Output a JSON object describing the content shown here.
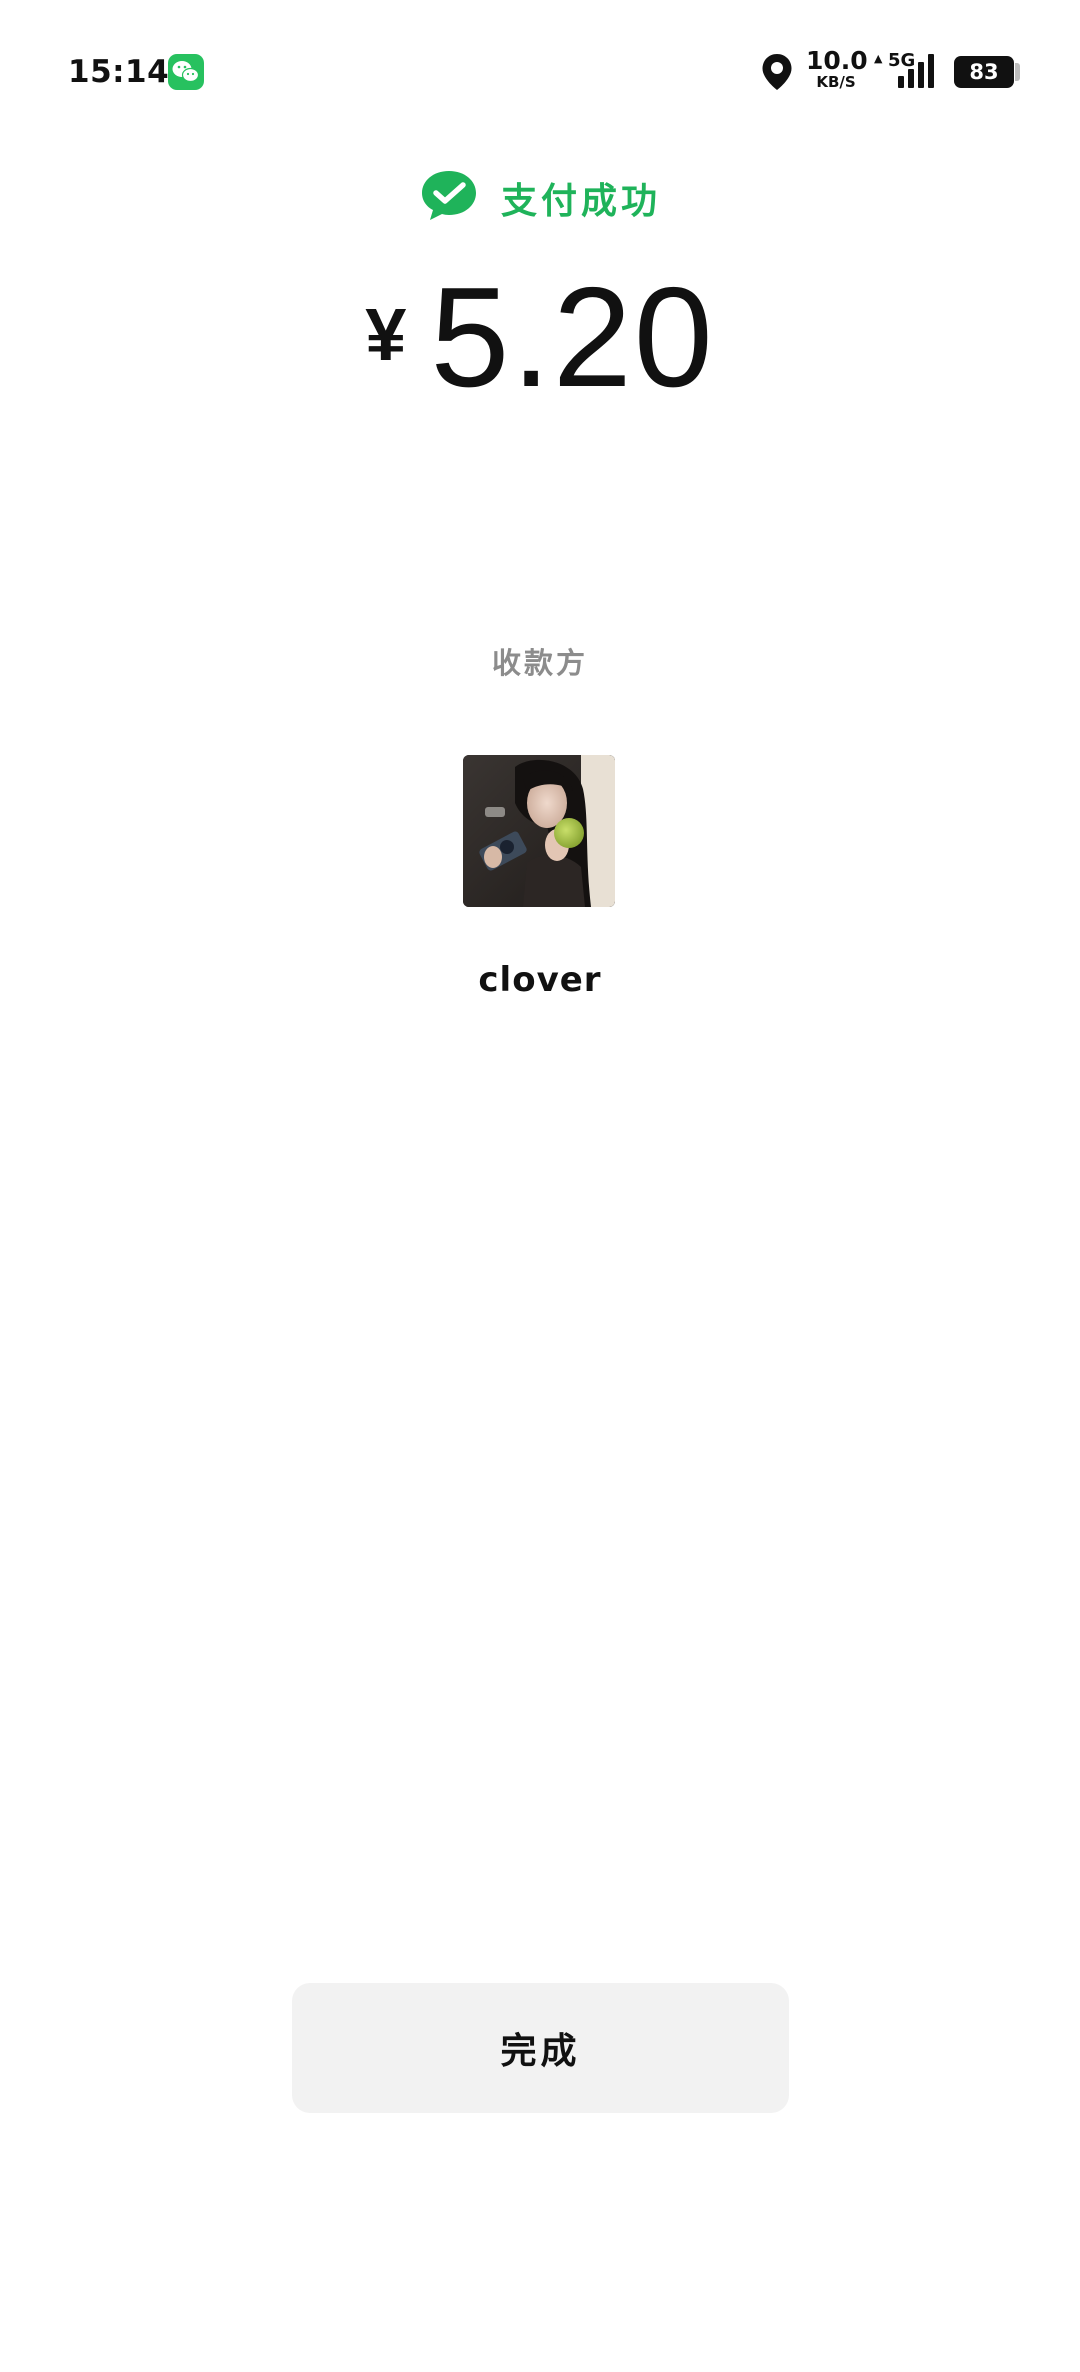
{
  "status_bar": {
    "time": "15:14",
    "app_icon": "wechat-icon",
    "location_icon": "location-pin-icon",
    "net_speed_value": "10.0",
    "net_speed_unit": "KB/S",
    "network_type": "5G",
    "signal_icon": "cellular-signal-icon",
    "battery_level": "83"
  },
  "success": {
    "icon": "wechat-pay-check-icon",
    "title": "支付成功",
    "accent_color": "#1fb35a"
  },
  "amount": {
    "currency_symbol": "¥",
    "value": "5.20"
  },
  "payee": {
    "label": "收款方",
    "avatar_icon": "payee-avatar-photo",
    "name": "clover"
  },
  "actions": {
    "done_label": "完成"
  }
}
